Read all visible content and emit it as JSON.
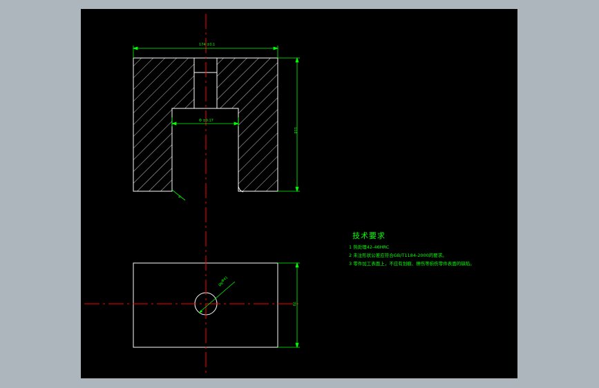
{
  "colors": {
    "background_outer": "#adb5bd",
    "canvas": "#000000",
    "outline": "#ffffff",
    "centerline": "#ff0000",
    "dimension": "#00ff00",
    "text": "#00ff00"
  },
  "dimensions": {
    "top_width": "174 ±0.1",
    "slot_width": "Φ ±0.17",
    "height": "118",
    "chamfer_note": "4",
    "hole_dia": "Φ41",
    "hole_note": "Ø6",
    "bottom_height": "70"
  },
  "tech_requirements": {
    "title": "技术要求",
    "lines": [
      "1  热处理42-46HRC",
      "2  未注形状公差应符合GB/T1184-2000的要求。",
      "3  零件加工表面上，不应有划痕、擦伤等损伤零件表面的缺陷。"
    ]
  }
}
